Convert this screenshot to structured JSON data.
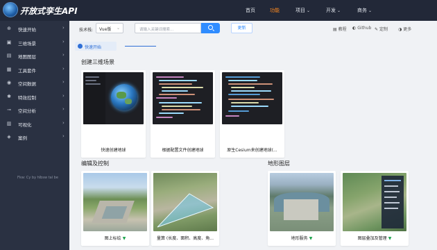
{
  "header": {
    "app_title": "开放式孪生API",
    "nav": [
      {
        "label": "首页",
        "has_menu": false,
        "active": false
      },
      {
        "label": "功能",
        "has_menu": false,
        "active": true
      },
      {
        "label": "项目",
        "has_menu": true,
        "active": false
      },
      {
        "label": "开发",
        "has_menu": true,
        "active": false
      },
      {
        "label": "商务",
        "has_menu": true,
        "active": false
      }
    ],
    "chevron": "⌄"
  },
  "sidebar": {
    "items": [
      {
        "label": "快速开始",
        "icon": "globe-icon",
        "glyph": "⊕"
      },
      {
        "label": "三维场景",
        "icon": "cube-icon",
        "glyph": "▣"
      },
      {
        "label": "地图图层",
        "icon": "layers-icon",
        "glyph": "▤"
      },
      {
        "label": "工具套件",
        "icon": "toolbox-icon",
        "glyph": "▦"
      },
      {
        "label": "空间数据",
        "icon": "database-icon",
        "glyph": "◉"
      },
      {
        "label": "特效控制",
        "icon": "gear-icon",
        "glyph": "✱"
      },
      {
        "label": "空间分析",
        "icon": "analysis-icon",
        "glyph": "⊸"
      },
      {
        "label": "可视化",
        "icon": "chart-icon",
        "glyph": "▥"
      },
      {
        "label": "案例",
        "icon": "case-icon",
        "glyph": "◈"
      }
    ],
    "arrow": "›",
    "note": "Fkw: Cy by hlbsw tal be"
  },
  "toolbar": {
    "tech_label": "技术栈:",
    "tech_value": "Vue版",
    "search_placeholder": "请输入关键词搜索…",
    "update_label": "更新",
    "links": [
      {
        "glyph": "▤",
        "label": "教程",
        "icon": "book-icon"
      },
      {
        "glyph": "◐",
        "label": "Github",
        "icon": "github-icon"
      },
      {
        "glyph": "✎",
        "label": "定制",
        "icon": "wrench-icon"
      },
      {
        "glyph": "◑",
        "label": "更多",
        "icon": "more-icon"
      }
    ]
  },
  "tab": {
    "label": "快速开始"
  },
  "sections": {
    "scene": {
      "title": "创建三维场景",
      "cards": [
        {
          "caption": "快速创建地球",
          "has_expand": false
        },
        {
          "caption": "根据配置文件创建地球",
          "has_expand": false
        },
        {
          "caption": "原生Cesium来创建地球(...",
          "has_expand": false
        }
      ]
    },
    "edit": {
      "title": "编辑及控制",
      "cards": [
        {
          "caption": "图上标绘",
          "has_expand": true
        },
        {
          "caption": "量算 (长度、面积、高度、角...",
          "has_expand": false
        }
      ]
    },
    "terrain": {
      "title": "地形图层",
      "cards": [
        {
          "caption": "地形服务",
          "has_expand": true
        },
        {
          "caption": "图层叠加及管理",
          "has_expand": true
        }
      ]
    }
  },
  "expand_glyph": "▼",
  "colors": {
    "header_bg": "#222838",
    "sidebar_bg": "#2a3142",
    "active_nav": "#ff8a1f",
    "primary": "#2f8cff"
  }
}
